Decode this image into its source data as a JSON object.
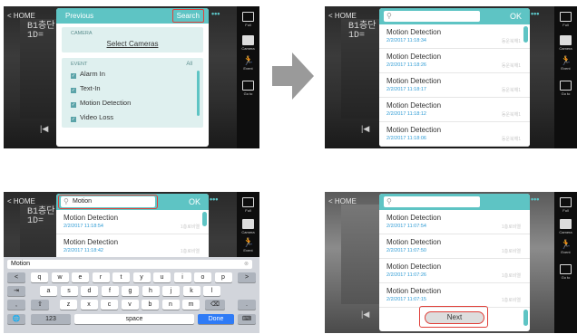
{
  "common": {
    "home_label": "< HOME",
    "sidebar": [
      {
        "name": "Full",
        "icon": "fullscreen-icon"
      },
      {
        "name": "Camera",
        "icon": "camera-icon"
      },
      {
        "name": "Event",
        "icon": "running-person-icon"
      },
      {
        "name": "Go to",
        "icon": "calendar-icon"
      }
    ],
    "more_dots": "•••",
    "camera_stamp": "B1층단\n1D=",
    "prev_button": "|◀",
    "accent_color": "#5ec4c4",
    "highlight_color": "#e0403a"
  },
  "panel1": {
    "previous_label": "Previous",
    "search_label": "Search",
    "camera_section_title": "CAMERA",
    "select_cameras_label": "Select Cameras",
    "event_section_title": "EVENT",
    "event_all_label": "All",
    "events": [
      "Alarm In",
      "Text-In",
      "Motion Detection",
      "Video Loss"
    ]
  },
  "panel2": {
    "ok_label": "OK",
    "search_value": "",
    "rows": [
      {
        "title": "Motion Detection",
        "date": "2/2/2017 11:18:34",
        "cam": "동운북해1"
      },
      {
        "title": "Motion Detection",
        "date": "2/2/2017 11:18:26",
        "cam": "동운북해1"
      },
      {
        "title": "Motion Detection",
        "date": "2/2/2017 11:18:17",
        "cam": "동운북해1"
      },
      {
        "title": "Motion Detection",
        "date": "2/2/2017 11:18:12",
        "cam": "동운북해1"
      },
      {
        "title": "Motion Detection",
        "date": "2/2/2017 11:18:06",
        "cam": "동운북해1"
      }
    ]
  },
  "panel3": {
    "ok_label": "OK",
    "search_value": "Motion",
    "rows": [
      {
        "title": "Motion Detection",
        "date": "2/2/2017 11:18:54",
        "cam": "1층로비엘"
      },
      {
        "title": "Motion Detection",
        "date": "2/2/2017 11:18:42",
        "cam": "1층로비엘"
      }
    ],
    "keyboard": {
      "field_value": "Motion",
      "row1": [
        "q",
        "w",
        "e",
        "r",
        "t",
        "y",
        "u",
        "i",
        "o",
        "p"
      ],
      "row2": [
        "a",
        "s",
        "d",
        "f",
        "g",
        "h",
        "j",
        "k",
        "l"
      ],
      "row3": [
        "z",
        "x",
        "c",
        "v",
        "b",
        "n",
        "m"
      ],
      "tab_key": "⇥",
      "shift_key": "⇧",
      "backspace_key": "⌫",
      "left_key": "<",
      "right_key": ">",
      "comma_key": ",",
      "period_key": ".",
      "globe_key": "🌐",
      "num_key": "123",
      "space_label": "space",
      "done_label": "Done",
      "hide_key": "⌨"
    }
  },
  "panel4": {
    "search_value": "",
    "rows": [
      {
        "title": "Motion Detection",
        "date": "2/2/2017 11:07:54",
        "cam": "1층로비엘"
      },
      {
        "title": "Motion Detection",
        "date": "2/2/2017 11:07:50",
        "cam": "1층로비엘"
      },
      {
        "title": "Motion Detection",
        "date": "2/2/2017 11:07:26",
        "cam": "1층로비엘"
      },
      {
        "title": "Motion Detection",
        "date": "2/2/2017 11:07:15",
        "cam": "1층로비엘"
      }
    ],
    "next_label": "Next"
  }
}
